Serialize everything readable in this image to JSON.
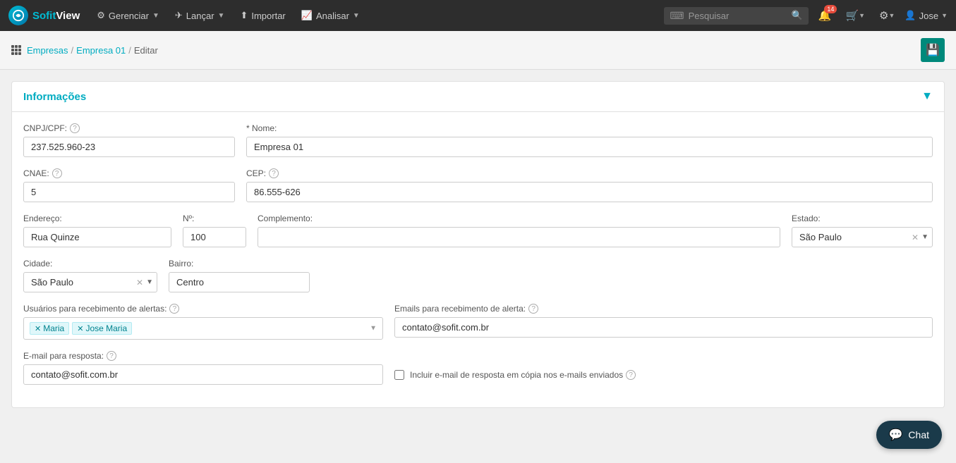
{
  "app": {
    "logo_sofit": "Sofit",
    "logo_view": "View"
  },
  "topnav": {
    "items": [
      {
        "label": "Gerenciar",
        "icon": "⚙",
        "has_dropdown": true
      },
      {
        "label": "Lançar",
        "icon": "✈",
        "has_dropdown": true
      },
      {
        "label": "Importar",
        "icon": "⬆",
        "has_dropdown": false
      },
      {
        "label": "Analisar",
        "icon": "📈",
        "has_dropdown": true
      }
    ],
    "search_placeholder": "Pesquisar",
    "notification_badge": "14",
    "user_label": "Jose"
  },
  "breadcrumb": {
    "items": [
      "Empresas",
      "Empresa 01",
      "Editar"
    ]
  },
  "card": {
    "title": "Informações",
    "fields": {
      "cnpj_label": "CNPJ/CPF:",
      "cnpj_value": "237.525.960-23",
      "nome_label": "* Nome:",
      "nome_value": "Empresa 01",
      "cnae_label": "CNAE:",
      "cnae_value": "5",
      "cep_label": "CEP:",
      "cep_value": "86.555-626",
      "endereco_label": "Endereço:",
      "endereco_value": "Rua Quinze",
      "no_label": "Nº:",
      "no_value": "100",
      "complemento_label": "Complemento:",
      "complemento_value": "",
      "estado_label": "Estado:",
      "estado_value": "São Paulo",
      "cidade_label": "Cidade:",
      "cidade_value": "São Paulo",
      "bairro_label": "Bairro:",
      "bairro_value": "Centro",
      "usuarios_label": "Usuários para recebimento de alertas:",
      "usuarios_tags": [
        "Maria",
        "Jose Maria"
      ],
      "emails_label": "Emails para recebimento de alerta:",
      "emails_value": "contato@sofit.com.br",
      "email_resposta_label": "E-mail para resposta:",
      "email_resposta_value": "contato@sofit.com.br",
      "include_copy_label": "Incluir e-mail de resposta em cópia nos e-mails enviados",
      "include_copy_checked": false
    }
  },
  "chat": {
    "label": "Chat"
  }
}
